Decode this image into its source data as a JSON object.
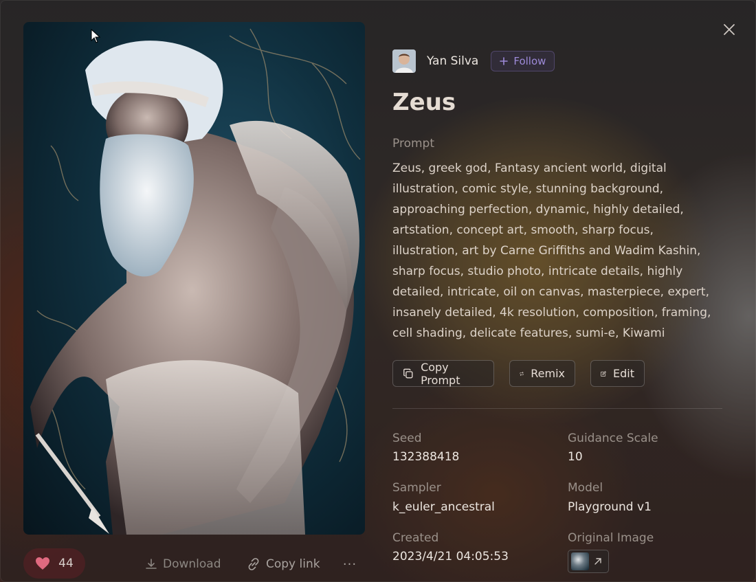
{
  "author": {
    "name": "Yan Silva",
    "follow_label": "Follow"
  },
  "title": "Zeus",
  "prompt": {
    "label": "Prompt",
    "text": "Zeus, greek god, Fantasy ancient world, digital illustration, comic style, stunning background, approaching perfection, dynamic, highly detailed, artstation, concept art, smooth, sharp focus, illustration, art by Carne Griffiths and Wadim Kashin, sharp focus, studio photo, intricate details, highly detailed, intricate, oil on canvas, masterpiece, expert, insanely detailed, 4k resolution, composition, framing, cell shading, delicate features, sumi-e, Kiwami"
  },
  "actions": {
    "copy_prompt": "Copy Prompt",
    "remix": "Remix",
    "edit": "Edit"
  },
  "details": {
    "seed_label": "Seed",
    "seed": "132388418",
    "guidance_label": "Guidance Scale",
    "guidance": "10",
    "sampler_label": "Sampler",
    "sampler": "k_euler_ancestral",
    "model_label": "Model",
    "model": "Playground v1",
    "created_label": "Created",
    "created": "2023/4/21 04:05:53",
    "original_label": "Original Image"
  },
  "bottom_bar": {
    "likes": "44",
    "download": "Download",
    "copy_link": "Copy link",
    "more": "···"
  },
  "icons": {
    "close": "close-icon",
    "like": "heart-icon",
    "download": "download-icon",
    "link": "link-icon",
    "copy": "copy-icon",
    "remix": "remix-icon",
    "edit": "edit-icon",
    "external": "arrow-up-right-icon",
    "plus": "plus-icon"
  },
  "colors": {
    "accent_follow": "#9d8ad8",
    "heart": "#e06a80"
  }
}
